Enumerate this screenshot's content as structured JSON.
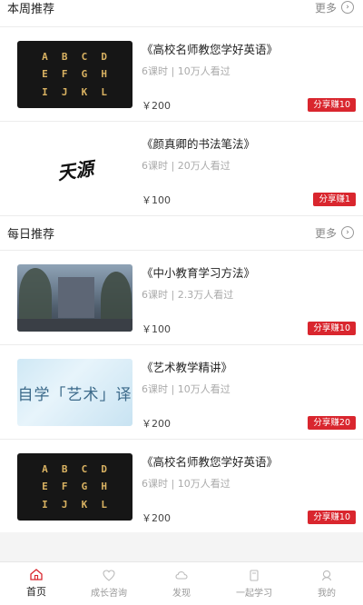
{
  "sections": {
    "weekly": {
      "title": "本周推荐",
      "more": "更多"
    },
    "daily": {
      "title": "每日推荐",
      "more": "更多"
    }
  },
  "weekly_courses": [
    {
      "title": "《高校名师教您学好英语》",
      "meta": "6课时 | 10万人看过",
      "price": "￥200",
      "share": "分享赚10",
      "thumb": "letters-grid"
    },
    {
      "title": "《颜真卿的书法笔法》",
      "meta": "6课时 | 20万人看过",
      "price": "￥100",
      "share": "分享赚1",
      "thumb": "calligraphy"
    }
  ],
  "daily_courses": [
    {
      "title": "《中小教育学习方法》",
      "meta": "6课时 | 2.3万人看过",
      "price": "￥100",
      "share": "分享赚10",
      "thumb": "campus-photo"
    },
    {
      "title": "《艺术教学精讲》",
      "meta": "6课时 | 10万人看过",
      "price": "￥200",
      "share": "分享赚20",
      "thumb": "art-text"
    },
    {
      "title": "《高校名师教您学好英语》",
      "meta": "6课时 | 10万人看过",
      "price": "￥200",
      "share": "分享赚10",
      "thumb": "letters-grid"
    }
  ],
  "thumbs": {
    "letters": [
      "A",
      "B",
      "C",
      "D",
      "E",
      "F",
      "G",
      "H",
      "I",
      "J",
      "K",
      "L"
    ],
    "calligraphy": "天源",
    "art": "自学「艺术」译"
  },
  "nav": [
    {
      "label": "首页",
      "icon": "home-icon",
      "active": true
    },
    {
      "label": "成长咨询",
      "icon": "heart-icon",
      "active": false
    },
    {
      "label": "发现",
      "icon": "cloud-icon",
      "active": false
    },
    {
      "label": "一起学习",
      "icon": "book-icon",
      "active": false
    },
    {
      "label": "我的",
      "icon": "user-icon",
      "active": false
    }
  ],
  "colors": {
    "accent": "#d9262e",
    "letters": "#d9b262",
    "nav_active": "#d9262e"
  }
}
